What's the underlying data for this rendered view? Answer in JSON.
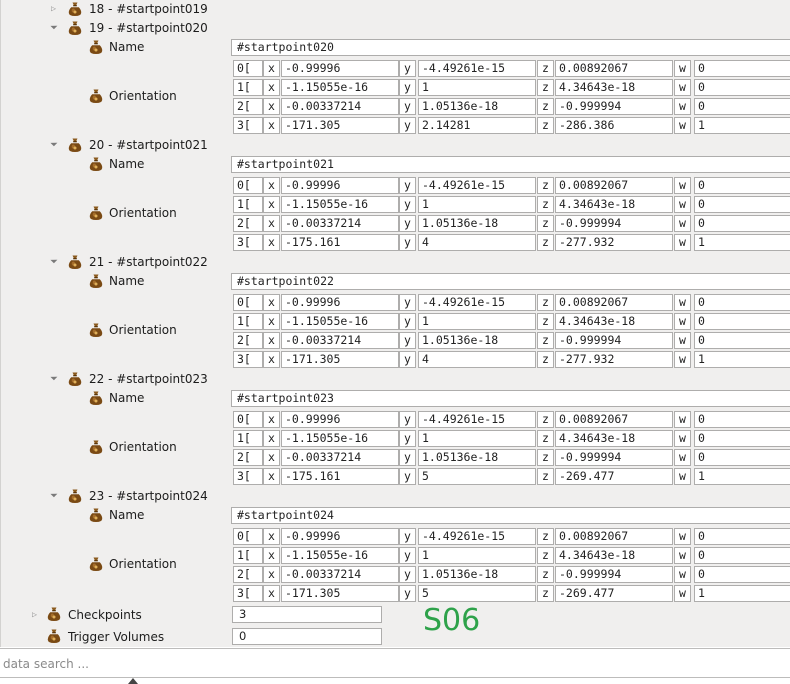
{
  "tree": {
    "collapsed_item": {
      "label": "18 - #startpoint019"
    },
    "startpoints": [
      {
        "label": "19 - #startpoint020",
        "name_label": "Name",
        "name_value": "#startpoint020",
        "orientation_label": "Orientation",
        "rows": [
          {
            "index": "0[",
            "x": "-0.99996",
            "y": "-4.49261e-15",
            "z": "0.00892067",
            "w": "0"
          },
          {
            "index": "1[",
            "x": "-1.15055e-16",
            "y": "1",
            "z": "4.34643e-18",
            "w": "0"
          },
          {
            "index": "2[",
            "x": "-0.00337214",
            "y": "1.05136e-18",
            "z": "-0.999994",
            "w": "0"
          },
          {
            "index": "3[",
            "x": "-171.305",
            "y": "2.14281",
            "z": "-286.386",
            "w": "1"
          }
        ]
      },
      {
        "label": "20 - #startpoint021",
        "name_label": "Name",
        "name_value": "#startpoint021",
        "orientation_label": "Orientation",
        "rows": [
          {
            "index": "0[",
            "x": "-0.99996",
            "y": "-4.49261e-15",
            "z": "0.00892067",
            "w": "0"
          },
          {
            "index": "1[",
            "x": "-1.15055e-16",
            "y": "1",
            "z": "4.34643e-18",
            "w": "0"
          },
          {
            "index": "2[",
            "x": "-0.00337214",
            "y": "1.05136e-18",
            "z": "-0.999994",
            "w": "0"
          },
          {
            "index": "3[",
            "x": "-175.161",
            "y": "4",
            "z": "-277.932",
            "w": "1"
          }
        ]
      },
      {
        "label": "21 - #startpoint022",
        "name_label": "Name",
        "name_value": "#startpoint022",
        "orientation_label": "Orientation",
        "rows": [
          {
            "index": "0[",
            "x": "-0.99996",
            "y": "-4.49261e-15",
            "z": "0.00892067",
            "w": "0"
          },
          {
            "index": "1[",
            "x": "-1.15055e-16",
            "y": "1",
            "z": "4.34643e-18",
            "w": "0"
          },
          {
            "index": "2[",
            "x": "-0.00337214",
            "y": "1.05136e-18",
            "z": "-0.999994",
            "w": "0"
          },
          {
            "index": "3[",
            "x": "-171.305",
            "y": "4",
            "z": "-277.932",
            "w": "1"
          }
        ]
      },
      {
        "label": "22 - #startpoint023",
        "name_label": "Name",
        "name_value": "#startpoint023",
        "orientation_label": "Orientation",
        "rows": [
          {
            "index": "0[",
            "x": "-0.99996",
            "y": "-4.49261e-15",
            "z": "0.00892067",
            "w": "0"
          },
          {
            "index": "1[",
            "x": "-1.15055e-16",
            "y": "1",
            "z": "4.34643e-18",
            "w": "0"
          },
          {
            "index": "2[",
            "x": "-0.00337214",
            "y": "1.05136e-18",
            "z": "-0.999994",
            "w": "0"
          },
          {
            "index": "3[",
            "x": "-175.161",
            "y": "5",
            "z": "-269.477",
            "w": "1"
          }
        ]
      },
      {
        "label": "23 - #startpoint024",
        "name_label": "Name",
        "name_value": "#startpoint024",
        "orientation_label": "Orientation",
        "rows": [
          {
            "index": "0[",
            "x": "-0.99996",
            "y": "-4.49261e-15",
            "z": "0.00892067",
            "w": "0"
          },
          {
            "index": "1[",
            "x": "-1.15055e-16",
            "y": "1",
            "z": "4.34643e-18",
            "w": "0"
          },
          {
            "index": "2[",
            "x": "-0.00337214",
            "y": "1.05136e-18",
            "z": "-0.999994",
            "w": "0"
          },
          {
            "index": "3[",
            "x": "-171.305",
            "y": "5",
            "z": "-269.477",
            "w": "1"
          }
        ]
      }
    ],
    "axis_letters": {
      "x": "x",
      "y": "y",
      "z": "z",
      "w": "w"
    },
    "checkpoints": {
      "label": "Checkpoints",
      "value": "3"
    },
    "trigger_volumes": {
      "label": "Trigger Volumes",
      "value": "0"
    }
  },
  "overlay_text": "S06",
  "search": {
    "placeholder": "data search ..."
  },
  "icons": {
    "node": "money-bag-icon",
    "expand": "triangle-right-icon",
    "collapse": "triangle-down-icon"
  },
  "colors": {
    "background": "#f0efee",
    "field": "#ffffff",
    "border": "#aeadac",
    "icon": "#7a4a14",
    "stamp": "#2ea24a"
  }
}
